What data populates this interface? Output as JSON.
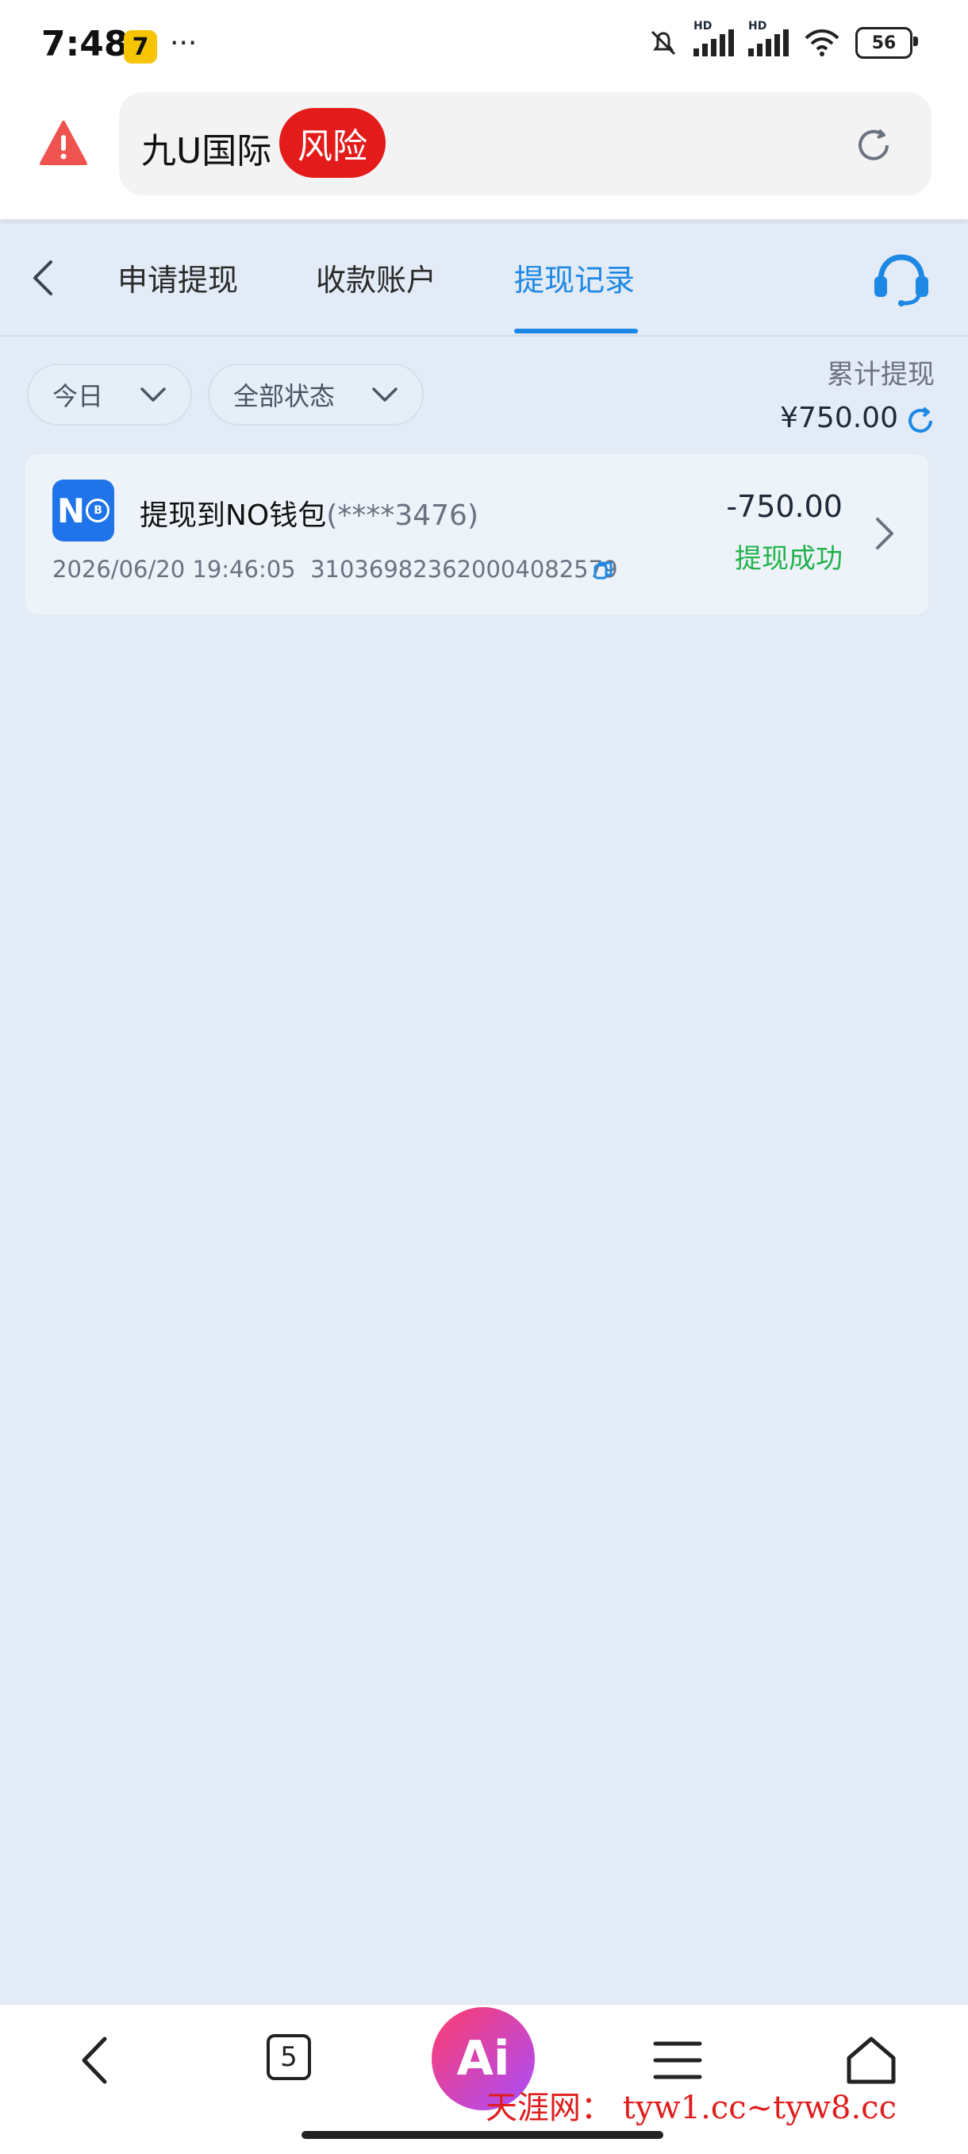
{
  "status_bar": {
    "time": "7:48",
    "app_badge_glyph": "7",
    "more": "···",
    "hd1": "HD",
    "hd2": "HD",
    "battery": "56"
  },
  "browser": {
    "site_name": "九U国际",
    "risk_label": "风险"
  },
  "tabs": [
    {
      "label": "申请提现",
      "active": false
    },
    {
      "label": "收款账户",
      "active": false
    },
    {
      "label": "提现记录",
      "active": true
    }
  ],
  "filters": {
    "date": "今日",
    "status": "全部状态"
  },
  "summary": {
    "label": "累计提现",
    "amount": "¥750.00"
  },
  "records": [
    {
      "logo_text": "N",
      "logo_coin": "B",
      "title": "提现到NO钱包",
      "account_mask": "(****3476)",
      "amount": "-750.00",
      "status": "提现成功",
      "datetime": "2026/06/20 19:46:05",
      "order_id": "310369823620004082579"
    }
  ],
  "bottom_nav": {
    "tab_count": "5",
    "ai_label": "Ai"
  },
  "watermark": "天涯网： tyw1.cc~tyw8.cc",
  "colors": {
    "accent": "#1e88e5",
    "success": "#22b34c",
    "risk": "#e31b1b",
    "page_bg": "#e3ebf6"
  }
}
